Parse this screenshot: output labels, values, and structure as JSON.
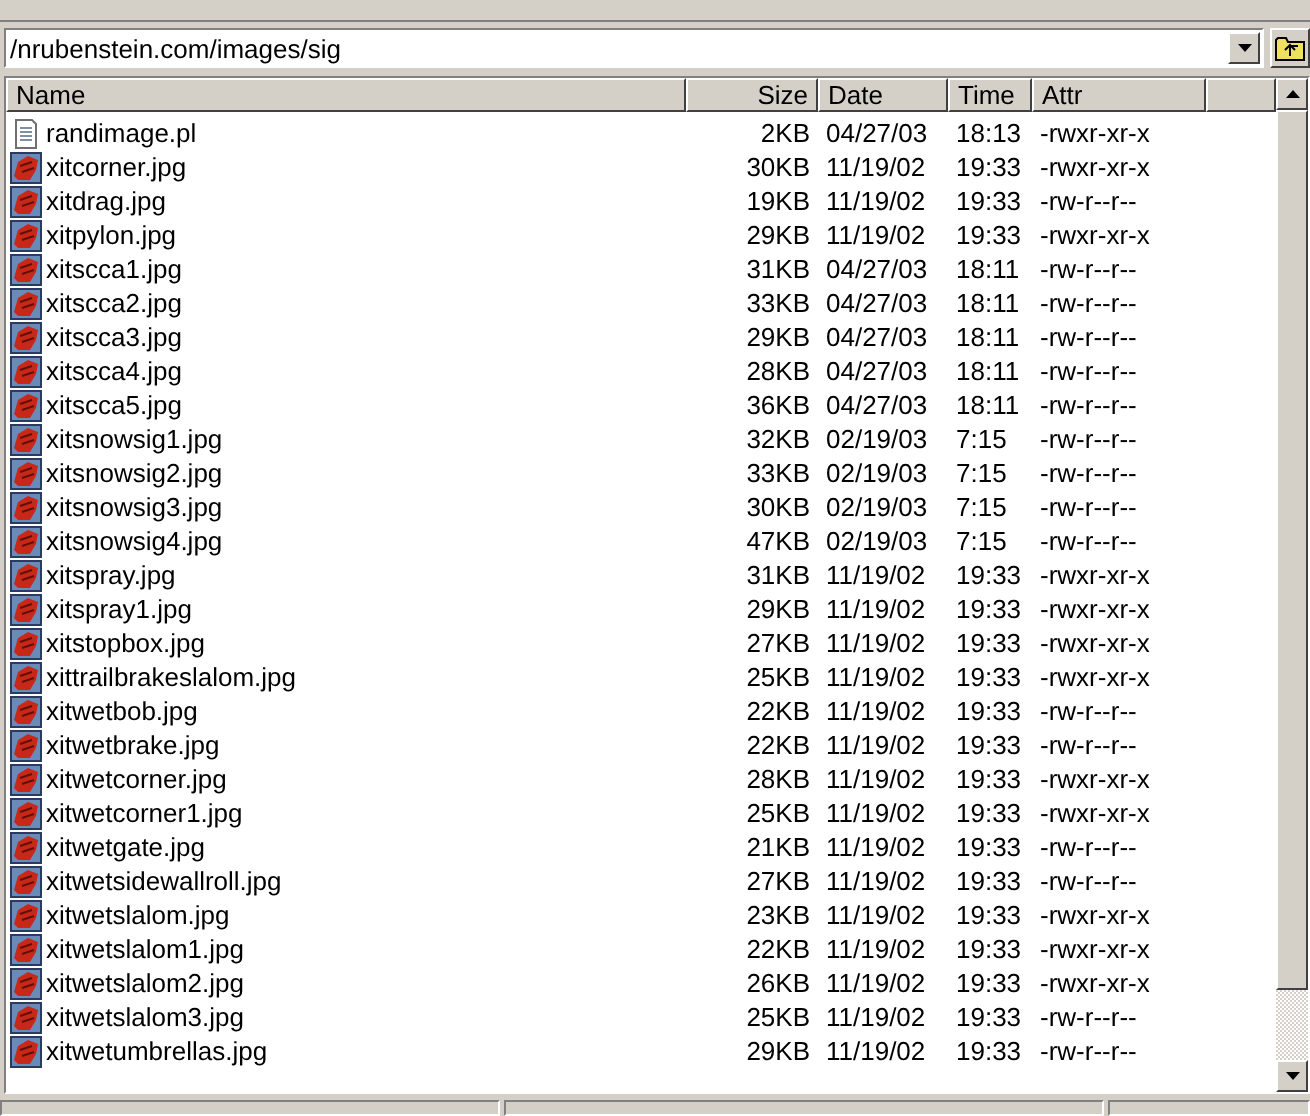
{
  "path_field": {
    "value": "/nrubenstein.com/images/sig"
  },
  "table": {
    "columns": [
      "Name",
      "Size",
      "Date",
      "Time",
      "Attr"
    ],
    "rows": [
      {
        "kind": "script",
        "name": "randimage.pl",
        "size": "2KB",
        "date": "04/27/03",
        "time": "18:13",
        "attr": "-rwxr-xr-x"
      },
      {
        "kind": "image",
        "name": "xitcorner.jpg",
        "size": "30KB",
        "date": "11/19/02",
        "time": "19:33",
        "attr": "-rwxr-xr-x"
      },
      {
        "kind": "image",
        "name": "xitdrag.jpg",
        "size": "19KB",
        "date": "11/19/02",
        "time": "19:33",
        "attr": "-rw-r--r--"
      },
      {
        "kind": "image",
        "name": "xitpylon.jpg",
        "size": "29KB",
        "date": "11/19/02",
        "time": "19:33",
        "attr": "-rwxr-xr-x"
      },
      {
        "kind": "image",
        "name": "xitscca1.jpg",
        "size": "31KB",
        "date": "04/27/03",
        "time": "18:11",
        "attr": "-rw-r--r--"
      },
      {
        "kind": "image",
        "name": "xitscca2.jpg",
        "size": "33KB",
        "date": "04/27/03",
        "time": "18:11",
        "attr": "-rw-r--r--"
      },
      {
        "kind": "image",
        "name": "xitscca3.jpg",
        "size": "29KB",
        "date": "04/27/03",
        "time": "18:11",
        "attr": "-rw-r--r--"
      },
      {
        "kind": "image",
        "name": "xitscca4.jpg",
        "size": "28KB",
        "date": "04/27/03",
        "time": "18:11",
        "attr": "-rw-r--r--"
      },
      {
        "kind": "image",
        "name": "xitscca5.jpg",
        "size": "36KB",
        "date": "04/27/03",
        "time": "18:11",
        "attr": "-rw-r--r--"
      },
      {
        "kind": "image",
        "name": "xitsnowsig1.jpg",
        "size": "32KB",
        "date": "02/19/03",
        "time": "7:15",
        "attr": "-rw-r--r--"
      },
      {
        "kind": "image",
        "name": "xitsnowsig2.jpg",
        "size": "33KB",
        "date": "02/19/03",
        "time": "7:15",
        "attr": "-rw-r--r--"
      },
      {
        "kind": "image",
        "name": "xitsnowsig3.jpg",
        "size": "30KB",
        "date": "02/19/03",
        "time": "7:15",
        "attr": "-rw-r--r--"
      },
      {
        "kind": "image",
        "name": "xitsnowsig4.jpg",
        "size": "47KB",
        "date": "02/19/03",
        "time": "7:15",
        "attr": "-rw-r--r--"
      },
      {
        "kind": "image",
        "name": "xitspray.jpg",
        "size": "31KB",
        "date": "11/19/02",
        "time": "19:33",
        "attr": "-rwxr-xr-x"
      },
      {
        "kind": "image",
        "name": "xitspray1.jpg",
        "size": "29KB",
        "date": "11/19/02",
        "time": "19:33",
        "attr": "-rwxr-xr-x"
      },
      {
        "kind": "image",
        "name": "xitstopbox.jpg",
        "size": "27KB",
        "date": "11/19/02",
        "time": "19:33",
        "attr": "-rwxr-xr-x"
      },
      {
        "kind": "image",
        "name": "xittrailbrakeslalom.jpg",
        "size": "25KB",
        "date": "11/19/02",
        "time": "19:33",
        "attr": "-rwxr-xr-x"
      },
      {
        "kind": "image",
        "name": "xitwetbob.jpg",
        "size": "22KB",
        "date": "11/19/02",
        "time": "19:33",
        "attr": "-rw-r--r--"
      },
      {
        "kind": "image",
        "name": "xitwetbrake.jpg",
        "size": "22KB",
        "date": "11/19/02",
        "time": "19:33",
        "attr": "-rw-r--r--"
      },
      {
        "kind": "image",
        "name": "xitwetcorner.jpg",
        "size": "28KB",
        "date": "11/19/02",
        "time": "19:33",
        "attr": "-rwxr-xr-x"
      },
      {
        "kind": "image",
        "name": "xitwetcorner1.jpg",
        "size": "25KB",
        "date": "11/19/02",
        "time": "19:33",
        "attr": "-rwxr-xr-x"
      },
      {
        "kind": "image",
        "name": "xitwetgate.jpg",
        "size": "21KB",
        "date": "11/19/02",
        "time": "19:33",
        "attr": "-rw-r--r--"
      },
      {
        "kind": "image",
        "name": "xitwetsidewallroll.jpg",
        "size": "27KB",
        "date": "11/19/02",
        "time": "19:33",
        "attr": "-rw-r--r--"
      },
      {
        "kind": "image",
        "name": "xitwetslalom.jpg",
        "size": "23KB",
        "date": "11/19/02",
        "time": "19:33",
        "attr": "-rwxr-xr-x"
      },
      {
        "kind": "image",
        "name": "xitwetslalom1.jpg",
        "size": "22KB",
        "date": "11/19/02",
        "time": "19:33",
        "attr": "-rwxr-xr-x"
      },
      {
        "kind": "image",
        "name": "xitwetslalom2.jpg",
        "size": "26KB",
        "date": "11/19/02",
        "time": "19:33",
        "attr": "-rwxr-xr-x"
      },
      {
        "kind": "image",
        "name": "xitwetslalom3.jpg",
        "size": "25KB",
        "date": "11/19/02",
        "time": "19:33",
        "attr": "-rw-r--r--"
      },
      {
        "kind": "image",
        "name": "xitwetumbrellas.jpg",
        "size": "29KB",
        "date": "11/19/02",
        "time": "19:33",
        "attr": "-rw-r--r--"
      }
    ]
  }
}
